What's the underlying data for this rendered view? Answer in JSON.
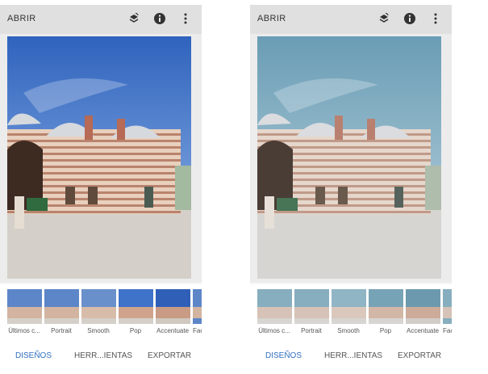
{
  "screens": [
    {
      "variant": "original",
      "topbar": {
        "open_label": "ABRIR",
        "icons": [
          "layers-icon",
          "info-icon",
          "more-vert-icon"
        ]
      },
      "colors": {
        "sky_top": "#3a6dc4",
        "sky_bottom": "#8fb3e4"
      },
      "looks": [
        "Últimos c...",
        "Portrait",
        "Smooth",
        "Pop",
        "Accentuate",
        "Fac"
      ],
      "nav": {
        "looks": "DISEÑOS",
        "tools": "HERR...IENTAS",
        "export": "EXPORTAR"
      }
    },
    {
      "variant": "filtered",
      "topbar": {
        "open_label": "ABRIR",
        "icons": [
          "layers-icon",
          "info-icon",
          "more-vert-icon"
        ]
      },
      "colors": {
        "sky_top": "#6fa1b6",
        "sky_bottom": "#c3d8df"
      },
      "looks": [
        "Últimos c...",
        "Portrait",
        "Smooth",
        "Pop",
        "Accentuate",
        "Fac"
      ],
      "nav": {
        "looks": "DISEÑOS",
        "tools": "HERR...IENTAS",
        "export": "EXPORTAR"
      }
    }
  ]
}
